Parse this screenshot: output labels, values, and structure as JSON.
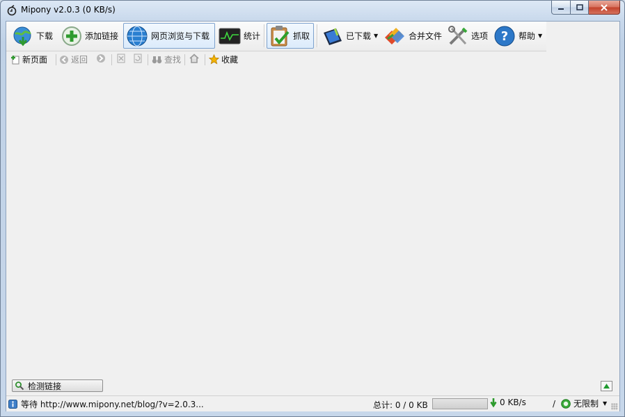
{
  "window": {
    "title": "Mipony v2.0.3 (0 KB/s)"
  },
  "toolbar": {
    "items": [
      {
        "label": "下载"
      },
      {
        "label": "添加链接"
      },
      {
        "label": "网页浏览与下载"
      },
      {
        "label": "统计"
      },
      {
        "label": "抓取"
      },
      {
        "label": "已下载"
      },
      {
        "label": "合并文件"
      },
      {
        "label": "选项"
      },
      {
        "label": "帮助"
      }
    ]
  },
  "navbar": {
    "new_page": "新页面",
    "back": "返回",
    "find": "查找",
    "favorites": "收藏"
  },
  "bottom": {
    "check_links": "检测链接"
  },
  "status": {
    "message": "等待 http://www.mipony.net/blog/?v=2.0.3...",
    "total": "总计: 0 / 0 KB",
    "speed": "0 KB/s",
    "slash": "/",
    "limit": "无限制",
    "progress": 0
  }
}
